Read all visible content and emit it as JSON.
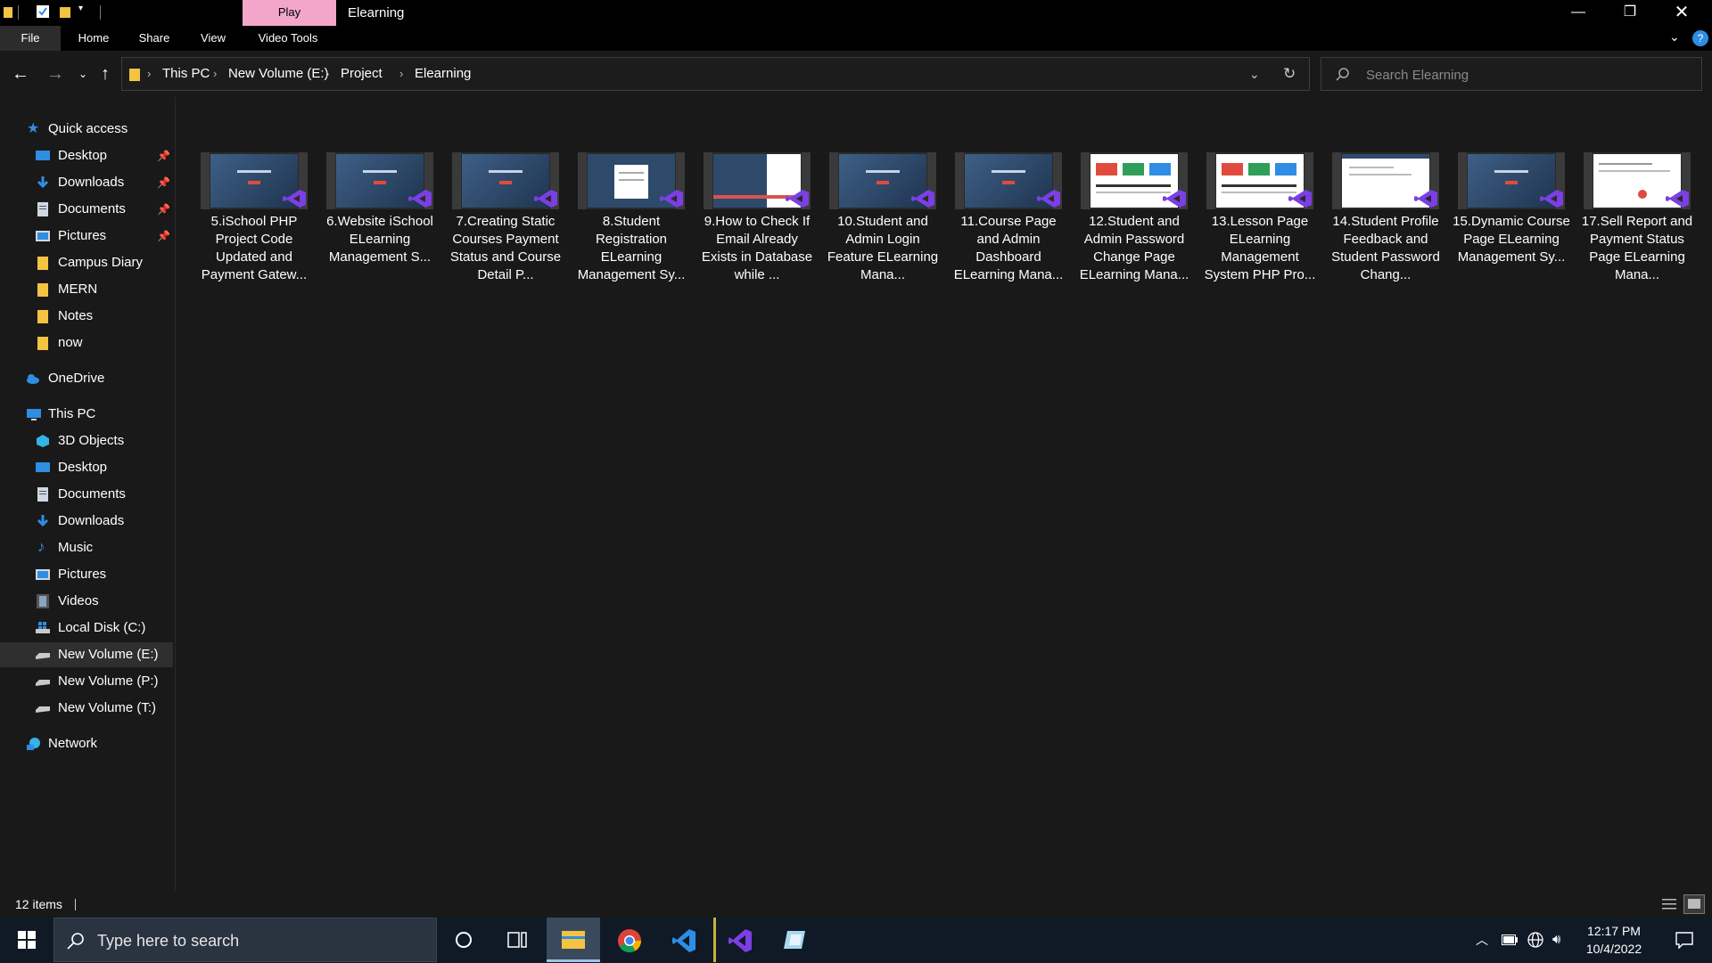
{
  "window": {
    "title": "Elearning",
    "play_tab": "Play"
  },
  "ribbon": {
    "tabs": [
      "File",
      "Home",
      "Share",
      "View",
      "Video Tools"
    ]
  },
  "address": {
    "crumbs": [
      "This PC",
      "New Volume (E:)",
      "Project",
      "Elearning"
    ]
  },
  "search": {
    "placeholder": "Search Elearning"
  },
  "nav": {
    "quick_access": "Quick access",
    "quick_items": [
      "Desktop",
      "Downloads",
      "Documents",
      "Pictures",
      "Campus Diary",
      "MERN",
      "Notes",
      "now"
    ],
    "onedrive": "OneDrive",
    "this_pc": "This PC",
    "pc_items": [
      "3D Objects",
      "Desktop",
      "Documents",
      "Downloads",
      "Music",
      "Pictures",
      "Videos",
      "Local Disk (C:)",
      "New Volume (E:)",
      "New Volume (P:)",
      "New Volume (T:)"
    ],
    "network": "Network",
    "selected": "New Volume (E:)"
  },
  "files": [
    {
      "label": "5.iSchool PHP Project Code Updated and Payment Gatew...",
      "thumb": "blue"
    },
    {
      "label": "6.Website iSchool ELearning Management S...",
      "thumb": "blue"
    },
    {
      "label": "7.Creating Static Courses Payment Status and Course Detail P...",
      "thumb": "blue"
    },
    {
      "label": "8.Student Registration ELearning Management Sy...",
      "thumb": "dialog"
    },
    {
      "label": "9.How to Check If Email Already Exists in Database while ...",
      "thumb": "form"
    },
    {
      "label": "10.Student and Admin Login Feature ELearning Mana...",
      "thumb": "blue"
    },
    {
      "label": "11.Course Page and Admin Dashboard ELearning Mana...",
      "thumb": "blue"
    },
    {
      "label": "12.Student and Admin Password Change Page ELearning Mana...",
      "thumb": "dashboard"
    },
    {
      "label": "13.Lesson Page ELearning Management System PHP Pro...",
      "thumb": "dashboard"
    },
    {
      "label": "14.Student Profile Feedback and Student Password Chang...",
      "thumb": "white"
    },
    {
      "label": "15.Dynamic Course Page ELearning Management Sy...",
      "thumb": "blue"
    },
    {
      "label": "17.Sell Report and Payment Status Page ELearning Mana...",
      "thumb": "report"
    }
  ],
  "status": {
    "items_count": "12 items"
  },
  "taskbar": {
    "search_placeholder": "Type here to search",
    "time": "12:17 PM",
    "date": "10/4/2022"
  },
  "colors": {
    "play_tab": "#f3a6c9",
    "accent_vs_purple": "#7b3fe4",
    "folder_yellow": "#f5c342",
    "blue_icon": "#2f8de4"
  }
}
